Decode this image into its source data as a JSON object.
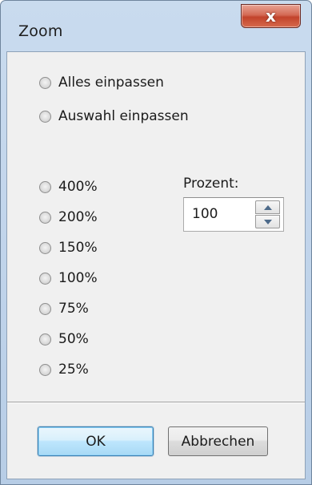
{
  "window": {
    "title": "Zoom",
    "close_glyph": "x"
  },
  "fit_options": [
    {
      "label": "Alles einpassen",
      "selected": false
    },
    {
      "label": "Auswahl einpassen",
      "selected": false
    }
  ],
  "zoom_options": [
    {
      "label": "400%",
      "selected": false
    },
    {
      "label": "200%",
      "selected": false
    },
    {
      "label": "150%",
      "selected": false
    },
    {
      "label": "100%",
      "selected": false
    },
    {
      "label": "75%",
      "selected": false
    },
    {
      "label": "50%",
      "selected": false
    },
    {
      "label": "25%",
      "selected": false
    }
  ],
  "percent": {
    "label": "Prozent:",
    "value": "100"
  },
  "buttons": {
    "ok_label": "OK",
    "cancel_label": "Abbrechen"
  },
  "icons": {
    "close": "close-icon",
    "spin_up": "chevron-up-icon",
    "spin_down": "chevron-down-icon"
  },
  "colors": {
    "frame": "#c3d6ec",
    "client": "#f0f0f0",
    "close_button": "#c2432b",
    "default_button_border": "#3c7fb1"
  }
}
